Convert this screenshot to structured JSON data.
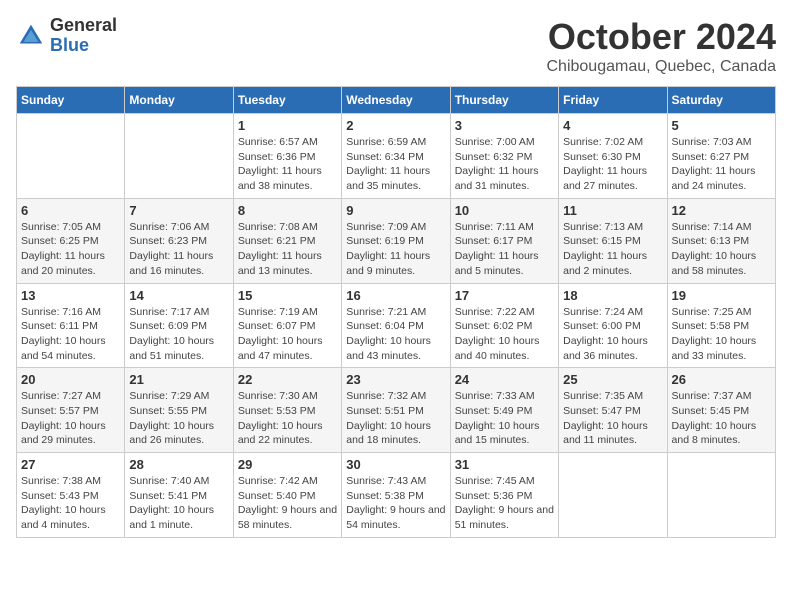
{
  "header": {
    "logo_general": "General",
    "logo_blue": "Blue",
    "month": "October 2024",
    "location": "Chibougamau, Quebec, Canada"
  },
  "weekdays": [
    "Sunday",
    "Monday",
    "Tuesday",
    "Wednesday",
    "Thursday",
    "Friday",
    "Saturday"
  ],
  "weeks": [
    [
      {
        "day": "",
        "info": ""
      },
      {
        "day": "",
        "info": ""
      },
      {
        "day": "1",
        "info": "Sunrise: 6:57 AM\nSunset: 6:36 PM\nDaylight: 11 hours and 38 minutes."
      },
      {
        "day": "2",
        "info": "Sunrise: 6:59 AM\nSunset: 6:34 PM\nDaylight: 11 hours and 35 minutes."
      },
      {
        "day": "3",
        "info": "Sunrise: 7:00 AM\nSunset: 6:32 PM\nDaylight: 11 hours and 31 minutes."
      },
      {
        "day": "4",
        "info": "Sunrise: 7:02 AM\nSunset: 6:30 PM\nDaylight: 11 hours and 27 minutes."
      },
      {
        "day": "5",
        "info": "Sunrise: 7:03 AM\nSunset: 6:27 PM\nDaylight: 11 hours and 24 minutes."
      }
    ],
    [
      {
        "day": "6",
        "info": "Sunrise: 7:05 AM\nSunset: 6:25 PM\nDaylight: 11 hours and 20 minutes."
      },
      {
        "day": "7",
        "info": "Sunrise: 7:06 AM\nSunset: 6:23 PM\nDaylight: 11 hours and 16 minutes."
      },
      {
        "day": "8",
        "info": "Sunrise: 7:08 AM\nSunset: 6:21 PM\nDaylight: 11 hours and 13 minutes."
      },
      {
        "day": "9",
        "info": "Sunrise: 7:09 AM\nSunset: 6:19 PM\nDaylight: 11 hours and 9 minutes."
      },
      {
        "day": "10",
        "info": "Sunrise: 7:11 AM\nSunset: 6:17 PM\nDaylight: 11 hours and 5 minutes."
      },
      {
        "day": "11",
        "info": "Sunrise: 7:13 AM\nSunset: 6:15 PM\nDaylight: 11 hours and 2 minutes."
      },
      {
        "day": "12",
        "info": "Sunrise: 7:14 AM\nSunset: 6:13 PM\nDaylight: 10 hours and 58 minutes."
      }
    ],
    [
      {
        "day": "13",
        "info": "Sunrise: 7:16 AM\nSunset: 6:11 PM\nDaylight: 10 hours and 54 minutes."
      },
      {
        "day": "14",
        "info": "Sunrise: 7:17 AM\nSunset: 6:09 PM\nDaylight: 10 hours and 51 minutes."
      },
      {
        "day": "15",
        "info": "Sunrise: 7:19 AM\nSunset: 6:07 PM\nDaylight: 10 hours and 47 minutes."
      },
      {
        "day": "16",
        "info": "Sunrise: 7:21 AM\nSunset: 6:04 PM\nDaylight: 10 hours and 43 minutes."
      },
      {
        "day": "17",
        "info": "Sunrise: 7:22 AM\nSunset: 6:02 PM\nDaylight: 10 hours and 40 minutes."
      },
      {
        "day": "18",
        "info": "Sunrise: 7:24 AM\nSunset: 6:00 PM\nDaylight: 10 hours and 36 minutes."
      },
      {
        "day": "19",
        "info": "Sunrise: 7:25 AM\nSunset: 5:58 PM\nDaylight: 10 hours and 33 minutes."
      }
    ],
    [
      {
        "day": "20",
        "info": "Sunrise: 7:27 AM\nSunset: 5:57 PM\nDaylight: 10 hours and 29 minutes."
      },
      {
        "day": "21",
        "info": "Sunrise: 7:29 AM\nSunset: 5:55 PM\nDaylight: 10 hours and 26 minutes."
      },
      {
        "day": "22",
        "info": "Sunrise: 7:30 AM\nSunset: 5:53 PM\nDaylight: 10 hours and 22 minutes."
      },
      {
        "day": "23",
        "info": "Sunrise: 7:32 AM\nSunset: 5:51 PM\nDaylight: 10 hours and 18 minutes."
      },
      {
        "day": "24",
        "info": "Sunrise: 7:33 AM\nSunset: 5:49 PM\nDaylight: 10 hours and 15 minutes."
      },
      {
        "day": "25",
        "info": "Sunrise: 7:35 AM\nSunset: 5:47 PM\nDaylight: 10 hours and 11 minutes."
      },
      {
        "day": "26",
        "info": "Sunrise: 7:37 AM\nSunset: 5:45 PM\nDaylight: 10 hours and 8 minutes."
      }
    ],
    [
      {
        "day": "27",
        "info": "Sunrise: 7:38 AM\nSunset: 5:43 PM\nDaylight: 10 hours and 4 minutes."
      },
      {
        "day": "28",
        "info": "Sunrise: 7:40 AM\nSunset: 5:41 PM\nDaylight: 10 hours and 1 minute."
      },
      {
        "day": "29",
        "info": "Sunrise: 7:42 AM\nSunset: 5:40 PM\nDaylight: 9 hours and 58 minutes."
      },
      {
        "day": "30",
        "info": "Sunrise: 7:43 AM\nSunset: 5:38 PM\nDaylight: 9 hours and 54 minutes."
      },
      {
        "day": "31",
        "info": "Sunrise: 7:45 AM\nSunset: 5:36 PM\nDaylight: 9 hours and 51 minutes."
      },
      {
        "day": "",
        "info": ""
      },
      {
        "day": "",
        "info": ""
      }
    ]
  ]
}
